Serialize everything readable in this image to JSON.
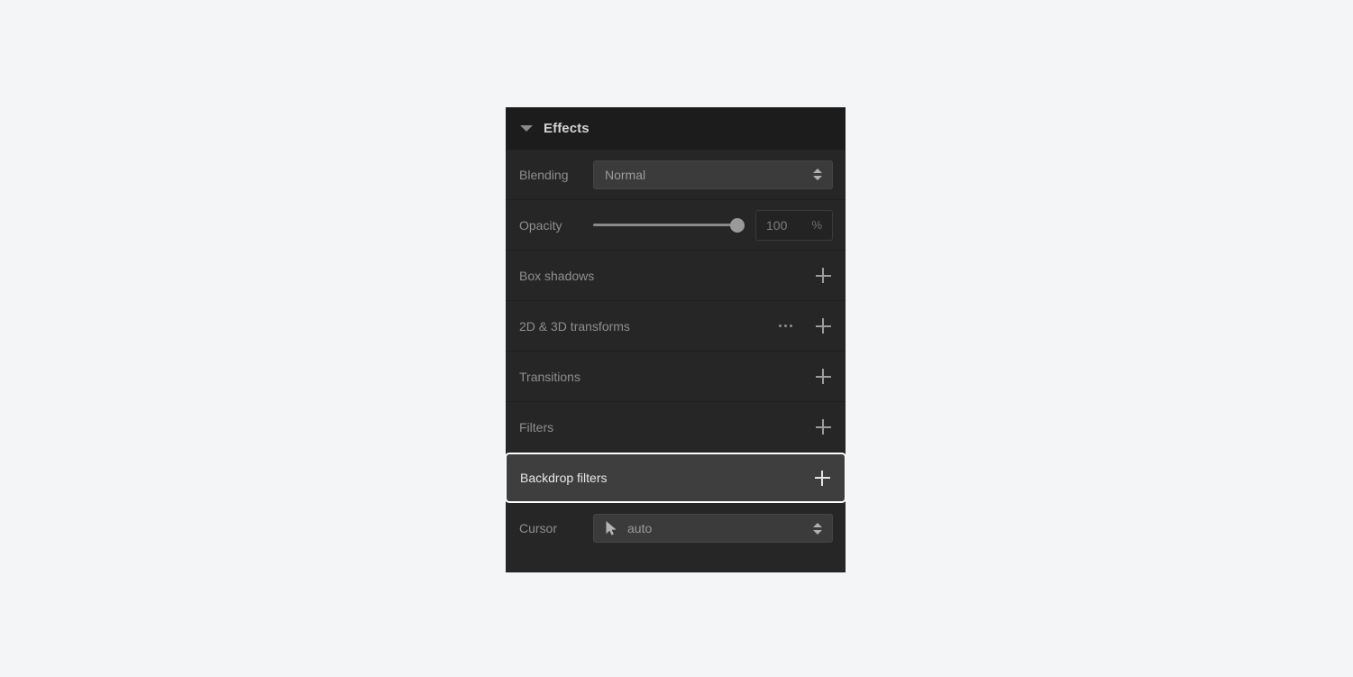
{
  "panel": {
    "title": "Effects",
    "disclosure_icon": "caret-down-icon",
    "expanded": true
  },
  "blending": {
    "label": "Blending",
    "value": "Normal",
    "stepper_icon": "stepper-arrows-icon"
  },
  "opacity": {
    "label": "Opacity",
    "value": "100",
    "unit": "%",
    "slider_percent": 100
  },
  "sections": [
    {
      "label": "Box shadows",
      "has_menu": false,
      "add_icon": "plus-icon",
      "selected": false
    },
    {
      "label": "2D & 3D transforms",
      "has_menu": true,
      "menu_icon": "ellipsis-icon",
      "add_icon": "plus-icon",
      "selected": false
    },
    {
      "label": "Transitions",
      "has_menu": false,
      "add_icon": "plus-icon",
      "selected": false
    },
    {
      "label": "Filters",
      "has_menu": false,
      "add_icon": "plus-icon",
      "selected": false
    },
    {
      "label": "Backdrop filters",
      "has_menu": false,
      "add_icon": "plus-icon",
      "selected": true
    }
  ],
  "cursor": {
    "label": "Cursor",
    "value": "auto",
    "glyph_icon": "mouse-pointer-icon",
    "stepper_icon": "stepper-arrows-icon"
  },
  "colors": {
    "page_background": "#f4f5f7",
    "panel_background": "#262626",
    "header_background": "#1c1c1c",
    "selected_row_background": "#3e3e3e",
    "selection_outline": "#ffffff",
    "label_text": "#8f8f8f",
    "title_text": "#d4d4d4",
    "control_background": "#3b3b3b"
  }
}
